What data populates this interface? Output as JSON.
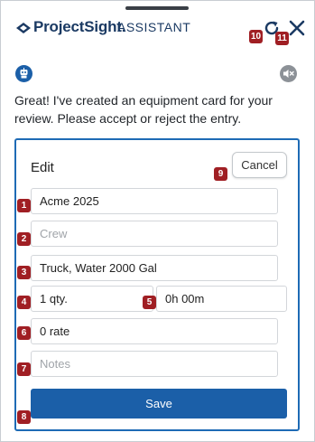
{
  "header": {
    "brand": "ProjectSight.",
    "subtitle": "ASSISTANT",
    "refresh_icon": "refresh-icon",
    "close_icon": "close-icon"
  },
  "assistant": {
    "avatar_icon": "robot-icon",
    "mute_icon": "speaker-mute-icon",
    "message": "Great! I've created an equipment card for your review. Please accept or reject the entry."
  },
  "card": {
    "title": "Edit",
    "cancel_label": "Cancel",
    "fields": {
      "equipment": {
        "value": "Acme 2025"
      },
      "crew": {
        "placeholder": "Crew"
      },
      "description": {
        "value": "Truck, Water 2000 Gal"
      },
      "quantity": {
        "value": "1 qty."
      },
      "duration": {
        "value": "0h 00m"
      },
      "rate": {
        "value": "0 rate"
      },
      "notes": {
        "placeholder": "Notes"
      }
    },
    "save_label": "Save"
  },
  "badges": [
    "1",
    "2",
    "3",
    "4",
    "5",
    "6",
    "7",
    "8",
    "9",
    "10",
    "11"
  ],
  "colors": {
    "brand": "#1b3a63",
    "accent": "#1b5fa8",
    "badge": "#a01f24",
    "card_border": "#1e6bb5"
  }
}
